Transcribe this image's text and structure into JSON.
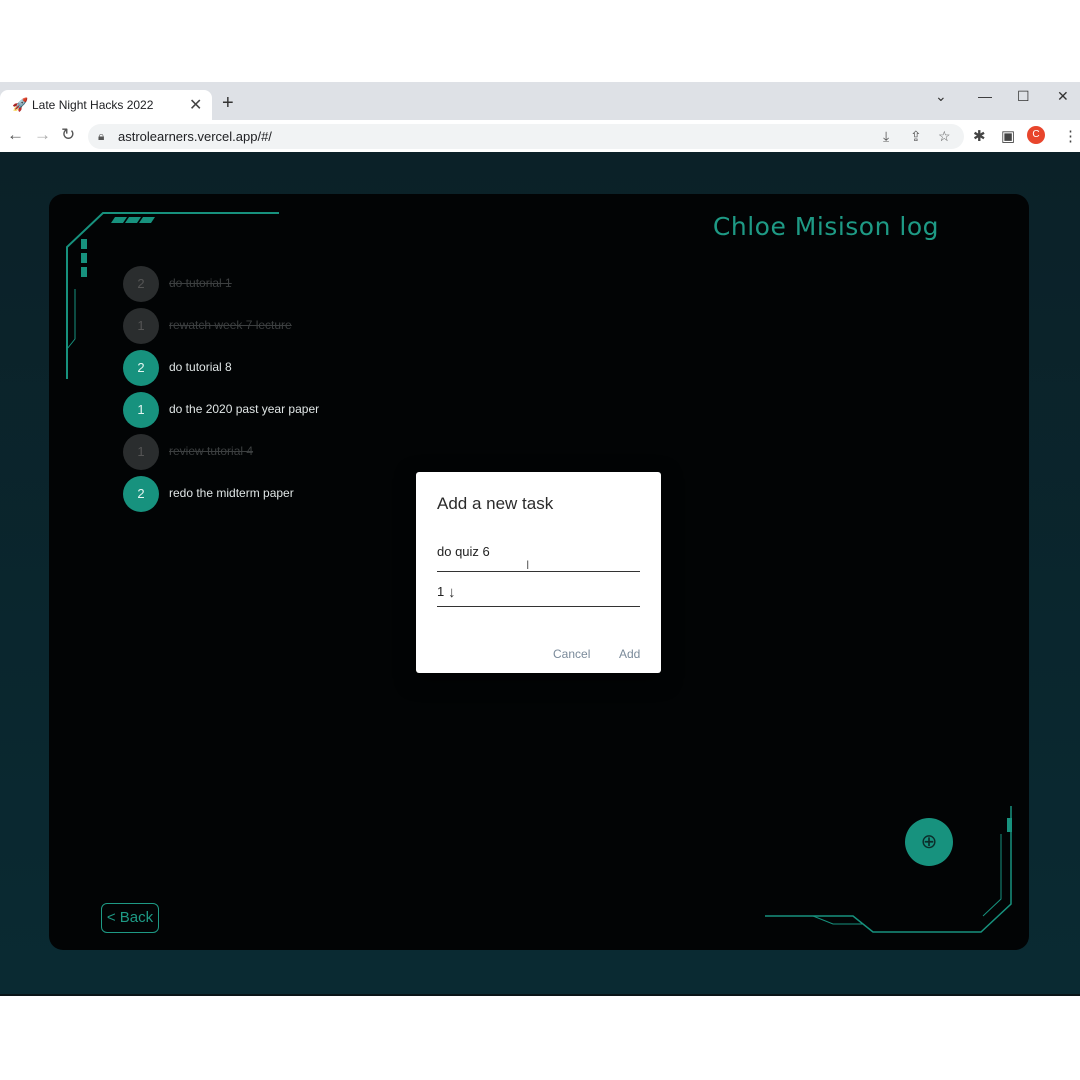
{
  "browser": {
    "tab_title": "Late Night Hacks 2022",
    "tab_favicon": "🚀",
    "url": "astrolearners.vercel.app/#/",
    "profile_initial": "C"
  },
  "app": {
    "title": "Chloe Misison log",
    "accent_color": "#1e9a85",
    "tasks": [
      {
        "priority": "2",
        "label": "do tutorial 1",
        "done": true
      },
      {
        "priority": "1",
        "label": "rewatch week 7 lecture",
        "done": true
      },
      {
        "priority": "2",
        "label": "do tutorial 8",
        "done": false
      },
      {
        "priority": "1",
        "label": "do the 2020 past year paper",
        "done": false
      },
      {
        "priority": "1",
        "label": "review tutorial 4",
        "done": true
      },
      {
        "priority": "2",
        "label": "redo the midterm paper",
        "done": false
      }
    ],
    "back_label": "< Back",
    "fab_icon": "add-task-icon"
  },
  "dialog": {
    "title": "Add a new task",
    "task_value": "do quiz 6",
    "priority_value": "1",
    "cancel_label": "Cancel",
    "add_label": "Add"
  }
}
